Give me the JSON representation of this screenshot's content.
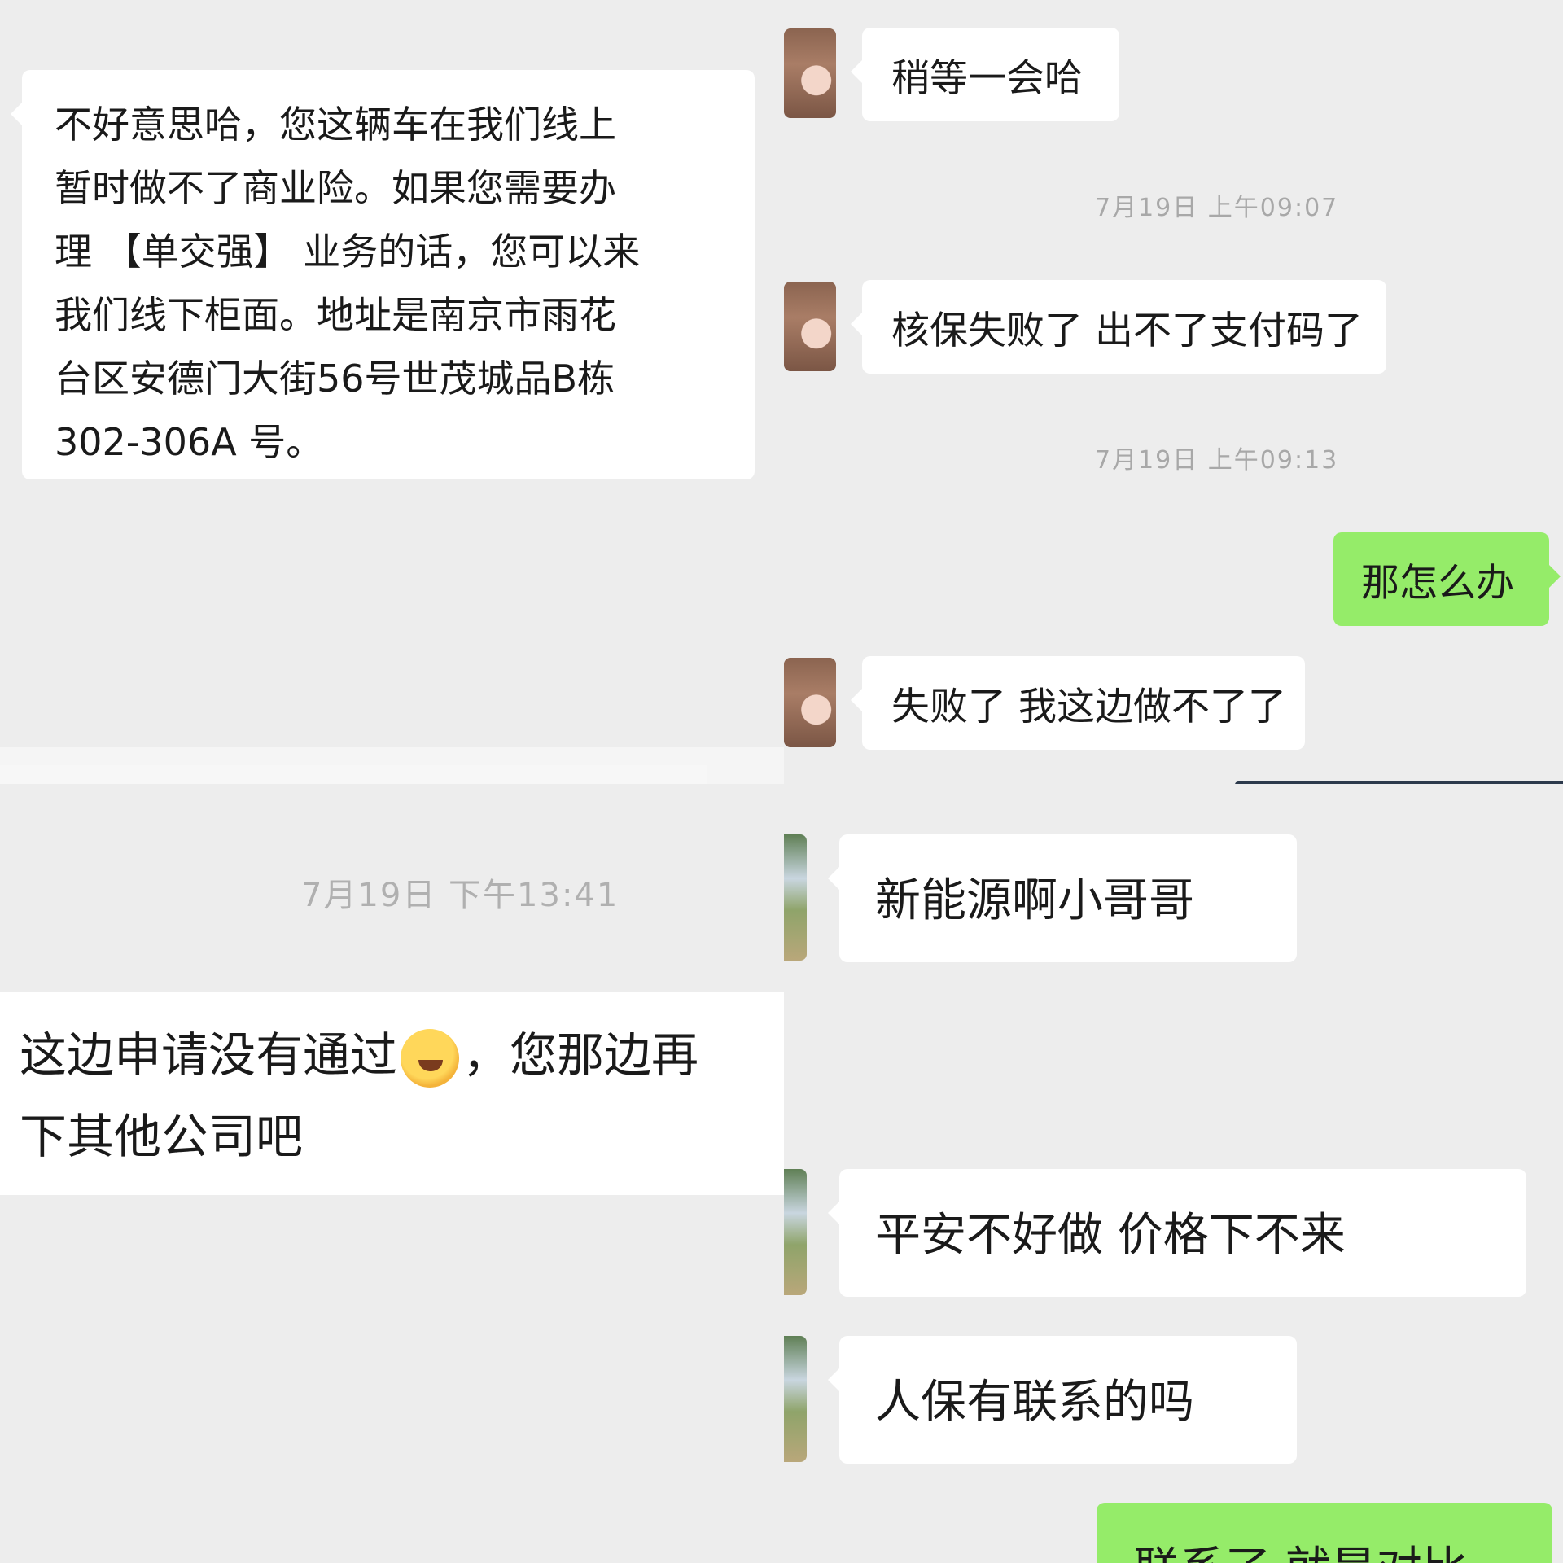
{
  "top_left": {
    "message": [
      "不好意思哈，您这辆车在我们线上",
      "暂时做不了商业险。如果您需要办",
      "理 【单交强】 业务的话，您可以来",
      "我们线下柜面。地址是南京市雨花",
      "台区安德门大街56号世茂城品B栋",
      "302-306A 号。"
    ]
  },
  "top_right": {
    "msg1": "稍等一会哈",
    "ts1": "7月19日 上午09:07",
    "msg2": "核保失败了 出不了支付码了",
    "ts2": "7月19日 上午09:13",
    "msg3_sent": "那怎么办",
    "msg4": "失败了 我这边做不了了"
  },
  "bottom_left": {
    "ts": "7月19日 下午13:41",
    "message_line1_a": "这边申请没有通过",
    "emoji": "crying-laughing-emoji",
    "message_line1_b": "，您那边再",
    "message_line2": "下其他公司吧"
  },
  "bottom_right": {
    "msg1": "新能源啊小哥哥",
    "msg2": "平安不好做  价格下不来",
    "msg3": "人保有联系的吗",
    "msg4_partial": "联系了  就是对比"
  },
  "colors": {
    "background": "#ededed",
    "bubble": "#ffffff",
    "sent_bubble": "#95ec69",
    "timestamp": "#a8a8a8"
  }
}
